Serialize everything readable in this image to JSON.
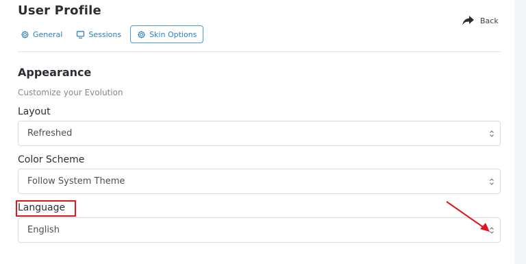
{
  "header": {
    "title": "User Profile",
    "back_label": "Back"
  },
  "tabs": [
    {
      "label": "General",
      "icon": "gear-icon",
      "active": false
    },
    {
      "label": "Sessions",
      "icon": "monitor-icon",
      "active": false
    },
    {
      "label": "Skin Options",
      "icon": "gear-icon",
      "active": true
    }
  ],
  "section": {
    "title": "Appearance",
    "subtitle": "Customize your Evolution"
  },
  "fields": {
    "layout": {
      "label": "Layout",
      "value": "Refreshed"
    },
    "color_scheme": {
      "label": "Color Scheme",
      "value": "Follow System Theme"
    },
    "language": {
      "label": "Language",
      "value": "English"
    }
  },
  "colors": {
    "accent": "#2a7fc1",
    "annotation": "#e3141c"
  }
}
